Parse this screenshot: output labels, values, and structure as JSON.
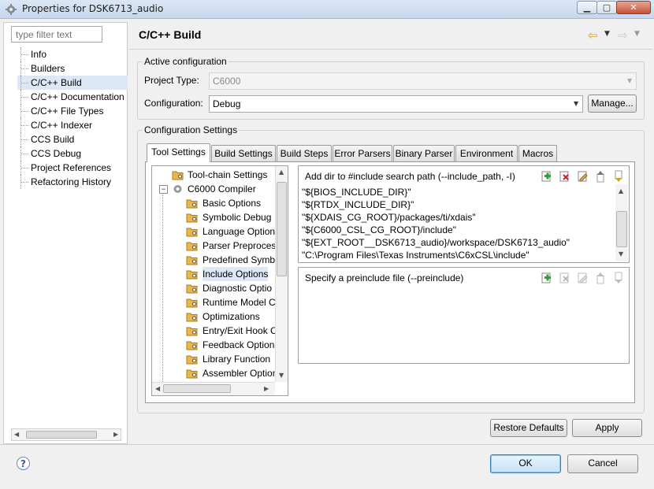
{
  "window": {
    "title": "Properties for DSK6713_audio",
    "controls": {
      "minimize": "▁",
      "maximize": "▢",
      "close": "✕"
    }
  },
  "sidebar": {
    "filter_placeholder": "type filter text",
    "items": [
      {
        "label": "Info"
      },
      {
        "label": "Builders"
      },
      {
        "label": "C/C++ Build",
        "selected": true
      },
      {
        "label": "C/C++ Documentation"
      },
      {
        "label": "C/C++ File Types"
      },
      {
        "label": "C/C++ Indexer"
      },
      {
        "label": "CCS Build"
      },
      {
        "label": "CCS Debug"
      },
      {
        "label": "Project References"
      },
      {
        "label": "Refactoring History"
      }
    ]
  },
  "page": {
    "heading": "C/C++ Build",
    "back_icon": "back-arrow-icon",
    "forward_icon": "forward-arrow-icon"
  },
  "active_configuration": {
    "group_label": "Active configuration",
    "project_type_label": "Project Type:",
    "project_type_value": "C6000",
    "configuration_label": "Configuration:",
    "configuration_value": "Debug",
    "manage_button": "Manage..."
  },
  "configuration_settings": {
    "group_label": "Configuration Settings",
    "tabs": [
      {
        "label": "Tool Settings",
        "active": true
      },
      {
        "label": "Build Settings"
      },
      {
        "label": "Build Steps"
      },
      {
        "label": "Error Parsers"
      },
      {
        "label": "Binary Parser"
      },
      {
        "label": "Environment"
      },
      {
        "label": "Macros"
      }
    ],
    "tool_tree": [
      {
        "label": "Tool-chain Settings",
        "level": 0
      },
      {
        "label": "C6000 Compiler",
        "level": 0,
        "expanded": true
      },
      {
        "label": "Basic Options",
        "level": 1
      },
      {
        "label": "Symbolic Debug",
        "level": 1
      },
      {
        "label": "Language Option",
        "level": 1
      },
      {
        "label": "Parser Preprocess",
        "level": 1
      },
      {
        "label": "Predefined Symb",
        "level": 1
      },
      {
        "label": "Include Options",
        "level": 1,
        "selected": true
      },
      {
        "label": "Diagnostic Optio",
        "level": 1
      },
      {
        "label": "Runtime Model C",
        "level": 1
      },
      {
        "label": "Optimizations",
        "level": 1
      },
      {
        "label": "Entry/Exit Hook C",
        "level": 1
      },
      {
        "label": "Feedback Option",
        "level": 1
      },
      {
        "label": "Library Function",
        "level": 1
      },
      {
        "label": "Assembler Option",
        "level": 1
      }
    ],
    "include_path": {
      "title": "Add dir to #include search path (--include_path, -I)",
      "toolbar_icons": [
        "add-icon",
        "delete-icon",
        "edit-icon",
        "move-up-icon",
        "move-down-icon"
      ],
      "items": [
        "\"${BIOS_INCLUDE_DIR}\"",
        "\"${RTDX_INCLUDE_DIR}\"",
        "\"${XDAIS_CG_ROOT}/packages/ti/xdais\"",
        "\"${C6000_CSL_CG_ROOT}/include\"",
        "\"${EXT_ROOT__DSK6713_audio}/workspace/DSK6713_audio\"",
        "\"C:\\Program Files\\Texas Instruments\\C6xCSL\\include\""
      ]
    },
    "preinclude": {
      "title": "Specify a preinclude file (--preinclude)",
      "toolbar_icons": [
        "add-icon",
        "delete-icon",
        "edit-icon",
        "move-up-icon",
        "move-down-icon"
      ],
      "items": []
    }
  },
  "buttons": {
    "restore_defaults": "Restore Defaults",
    "apply": "Apply",
    "ok": "OK",
    "cancel": "Cancel",
    "help": "?"
  },
  "colors": {
    "accent": "#3c7fb1",
    "selection": "#dde8f6",
    "folder": "#e8b84a"
  }
}
